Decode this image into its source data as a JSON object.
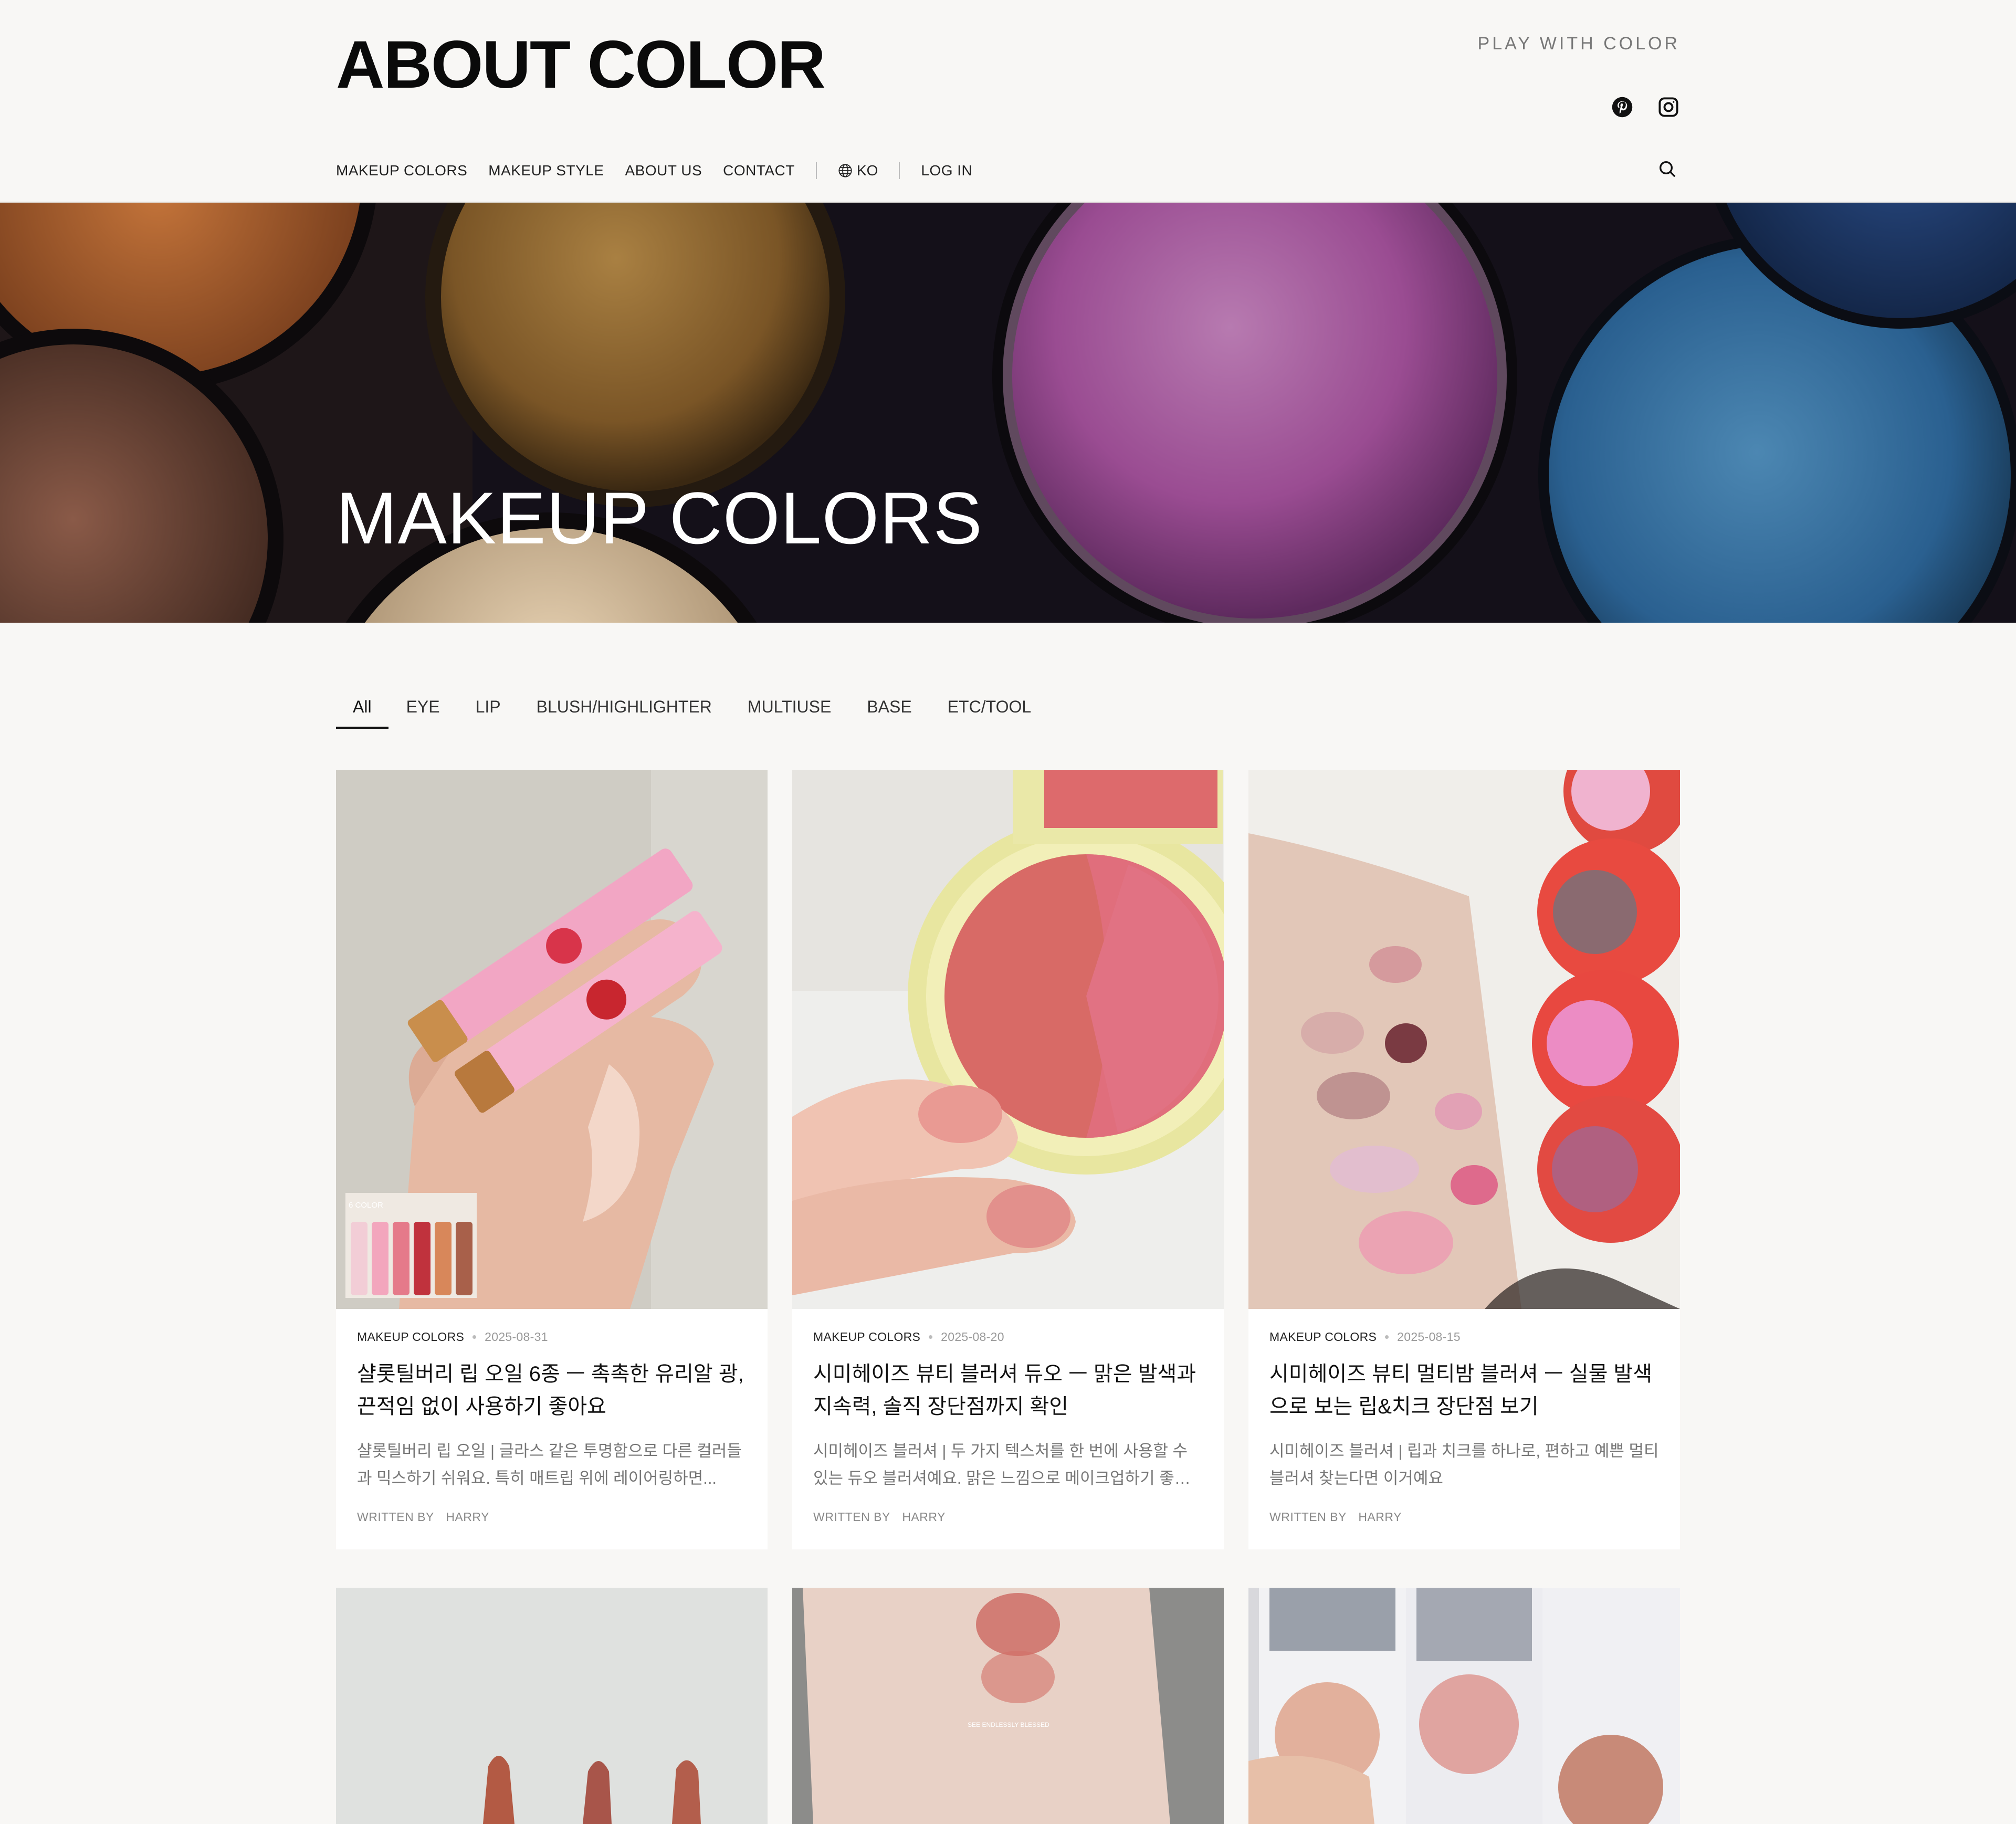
{
  "site": {
    "logo": "ABOUT COLOR",
    "tagline": "PLAY WITH COLOR",
    "socials": [
      "pinterest-icon",
      "instagram-icon"
    ]
  },
  "nav": {
    "items": [
      "MAKEUP COLORS",
      "MAKEUP STYLE",
      "ABOUT US",
      "CONTACT"
    ],
    "lang": "KO",
    "login": "LOG IN"
  },
  "hero": {
    "title": "MAKEUP COLORS"
  },
  "tabs": [
    "All",
    "EYE",
    "LIP",
    "BLUSH/HIGHLIGHTER",
    "MULTIUSE",
    "BASE",
    "ETC/TOOL"
  ],
  "active_tab": "All",
  "cards": [
    {
      "category": "MAKEUP COLORS",
      "date": "2025-08-31",
      "title": "샬롯틸버리 립 오일 6종 ㅡ 촉촉한 유리알 광, 끈적임 없이 사용하기 좋아요",
      "excerpt": "샬롯틸버리 립 오일 | 글라스 같은 투명함으로 다른 컬러들과 믹스하기 쉬워요. 특히 매트립 위에 레이어링하면...",
      "written_by": "WRITTEN BY",
      "author": "HARRY",
      "image_label": "6 COLOR"
    },
    {
      "category": "MAKEUP COLORS",
      "date": "2025-08-20",
      "title": "시미헤이즈 뷰티 블러셔 듀오 ㅡ 맑은 발색과 지속력, 솔직 장단점까지 확인",
      "excerpt": "시미헤이즈 블러셔 | 두 가지 텍스처를 한 번에 사용할 수 있는 듀오 블러셔예요. 맑은 느낌으로 메이크업하기 좋은 ...",
      "written_by": "WRITTEN BY",
      "author": "HARRY"
    },
    {
      "category": "MAKEUP COLORS",
      "date": "2025-08-15",
      "title": "시미헤이즈 뷰티 멀티밤 블러셔 ㅡ 실물 발색으로 보는 립&치크 장단점 보기",
      "excerpt": "시미헤이즈 블러셔 | 립과 치크를 하나로, 편하고 예쁜 멀티블러셔 찾는다면 이거예요",
      "written_by": "WRITTEN BY",
      "author": "HARRY"
    }
  ],
  "second_row_labels": [
    "SEE ENDLESSLY BLESSED"
  ],
  "colors": {
    "background": "#f8f7f5",
    "text": "#222222",
    "muted": "#777777"
  }
}
